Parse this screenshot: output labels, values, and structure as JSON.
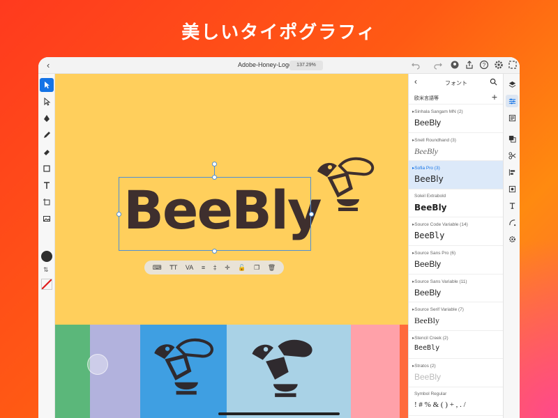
{
  "headline": "美しいタイポグラフィ",
  "topbar": {
    "back_icon": "chevron-left-icon",
    "document_title": "Adobe-Honey-Logo",
    "zoom": "137.29%",
    "icons": [
      "undo-icon",
      "redo-icon",
      "cloud-user-icon",
      "share-icon",
      "help-icon",
      "gear-icon",
      "export-icon"
    ]
  },
  "left_tools": [
    "select-tool",
    "direct-select-tool",
    "pen-tool",
    "pencil-tool",
    "eraser-tool",
    "shape-tool",
    "type-tool",
    "transform-tool",
    "image-tool"
  ],
  "canvas": {
    "logo_text": "BeeBly",
    "artboard_color": "#ffcf5c",
    "context_bar_icons": [
      "text-box-icon",
      "font-size-icon",
      "tracking-icon",
      "line-height-icon",
      "baseline-icon",
      "align-icon",
      "lock-icon",
      "duplicate-icon",
      "trash-icon"
    ]
  },
  "font_panel": {
    "title": "フォント",
    "language": "欧米言語等",
    "fonts": [
      {
        "name": "Sinhala Sangam MN (2)",
        "sample": "BeeBly",
        "selected": false
      },
      {
        "name": "Snell Roundhand (3)",
        "sample": "BeeBly",
        "selected": false
      },
      {
        "name": "Sofia Pro (3)",
        "sample": "BeeBly",
        "selected": true
      },
      {
        "name": "Soleil Extrabold",
        "sample": "BeeBly",
        "selected": false
      },
      {
        "name": "Source Code Variable (14)",
        "sample": "BeeBly",
        "selected": false
      },
      {
        "name": "Source Sans Pro (6)",
        "sample": "BeeBly",
        "selected": false
      },
      {
        "name": "Source Sans Variable (11)",
        "sample": "BeeBly",
        "selected": false
      },
      {
        "name": "Source Serif Variable (7)",
        "sample": "BeeBly",
        "selected": false
      },
      {
        "name": "Stencil Creek (2)",
        "sample": "BeeBly",
        "selected": false
      },
      {
        "name": "Stratos (2)",
        "sample": "BeeBly",
        "selected": false
      },
      {
        "name": "Symbol Regular",
        "sample": "! # % & ( ) + , . /",
        "selected": false
      }
    ]
  },
  "right_rail": [
    "layers-icon",
    "properties-icon",
    "fill-icon",
    "arrange-icon",
    "cut-icon",
    "align-icon",
    "frame-icon",
    "text-style-icon",
    "curve-icon",
    "settings-icon"
  ],
  "colors": {
    "accent": "#1473e6",
    "ink": "#3e2f2e",
    "stroke_swatch": "#e01f1f"
  }
}
